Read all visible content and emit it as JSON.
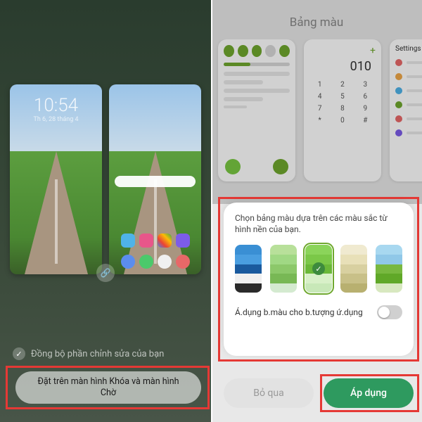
{
  "left": {
    "clock": "10:54",
    "date": "Th 6, 28 tháng 4",
    "sync_label": "Đồng bộ phần chỉnh sửa của bạn",
    "main_button": "Đặt trên màn hình Khóa và màn hình Chờ"
  },
  "right": {
    "title": "Bảng màu",
    "preview_number": "010",
    "preview_settings": "Settings",
    "palette_desc": "Chọn bảng màu dựa trên các màu sắc từ hình nền của bạn.",
    "swatches": [
      {
        "colors": [
          "#3a8fd4",
          "#4a9ee0",
          "#1a5a9e",
          "#f0f0f0",
          "#2a2a2a"
        ],
        "selected": false
      },
      {
        "colors": [
          "#b8e09a",
          "#a0d884",
          "#8cc86a",
          "#78b855",
          "#d4ead0"
        ],
        "selected": false
      },
      {
        "colors": [
          "#8bd45a",
          "#7bc848",
          "#6ab838",
          "#d8f0c8",
          "#c8e8b8"
        ],
        "selected": true
      },
      {
        "colors": [
          "#f0ead0",
          "#e8e0b8",
          "#d8d0a0",
          "#c8c088",
          "#b8b070"
        ],
        "selected": false
      },
      {
        "colors": [
          "#a8d8f0",
          "#90c8e8",
          "#78b840",
          "#60a828",
          "#d8e8c0"
        ],
        "selected": false
      }
    ],
    "apply_icons_label": "Á.dụng b.màu cho b.tượng ứ.dụng",
    "skip_label": "Bỏ qua",
    "apply_label": "Áp dụng",
    "keypad": [
      "1",
      "2",
      "3",
      "4",
      "5",
      "6",
      "7",
      "8",
      "9",
      "*",
      "0",
      "#"
    ]
  }
}
